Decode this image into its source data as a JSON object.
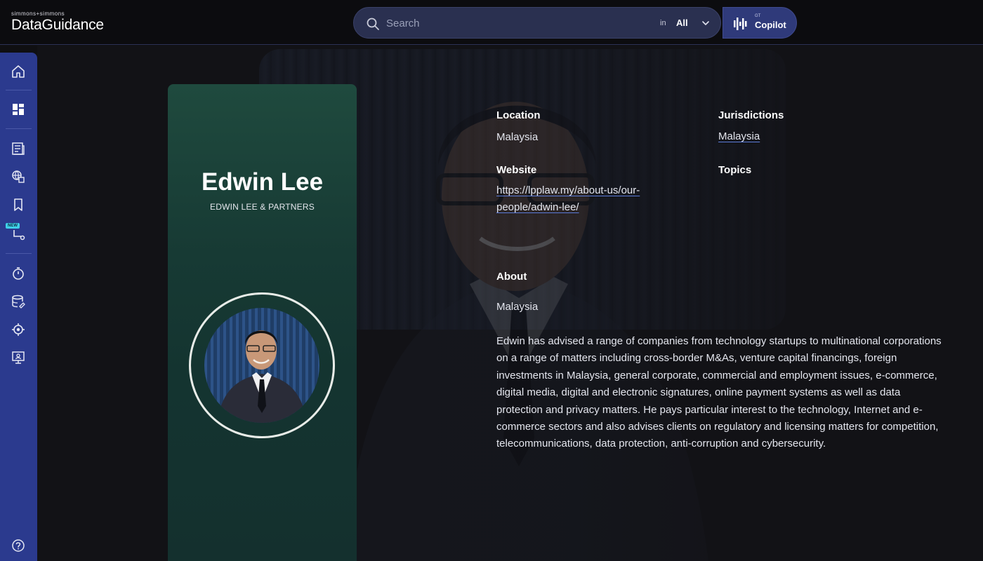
{
  "header": {
    "logo_small": "simmons+simmons",
    "logo_main": "DataGuidance",
    "search": {
      "placeholder": "Search",
      "scope_in": "in",
      "scope_value": "All"
    },
    "copilot": {
      "superscript": "GT",
      "label": "Copilot"
    }
  },
  "sidebar": {
    "items": [
      {
        "icon": "home-icon"
      },
      {
        "icon": "dashboard-icon"
      },
      {
        "icon": "news-icon"
      },
      {
        "icon": "regulations-icon"
      },
      {
        "icon": "bookmark-icon"
      },
      {
        "icon": "workflow-icon",
        "badge": "NEW"
      },
      {
        "icon": "timer-icon"
      },
      {
        "icon": "database-icon"
      },
      {
        "icon": "target-icon"
      },
      {
        "icon": "presentation-icon"
      },
      {
        "icon": "help-icon"
      }
    ]
  },
  "profile": {
    "name": "Edwin Lee",
    "firm": "EDWIN LEE & PARTNERS",
    "location_label": "Location",
    "location_value": "Malaysia",
    "jurisdictions_label": "Jurisdictions",
    "jurisdictions_value": "Malaysia",
    "website_label": "Website",
    "website_line1": "https://lpplaw.my/about-us/our-",
    "website_line2": "people/adwin-lee/",
    "topics_label": "Topics",
    "about_label": "About",
    "about_country": "Malaysia",
    "about_text": "Edwin has advised a range of companies from technology startups to multinational corporations on a range of matters including cross-border M&As, venture capital financings, foreign investments in Malaysia, general corporate, commercial and employment issues, e-commerce, digital media, digital and electronic signatures, online payment systems as well as data protection and privacy matters. He pays particular interest to the technology, Internet and e-commerce sectors and also advises clients on regulatory and licensing matters for competition, telecommunications, data protection, anti-corruption and cybersecurity."
  },
  "colors": {
    "sidebar": "#2b3a8e",
    "card": "#1f4a3e",
    "copilot": "#2f3a7a",
    "search": "#2a3050"
  }
}
